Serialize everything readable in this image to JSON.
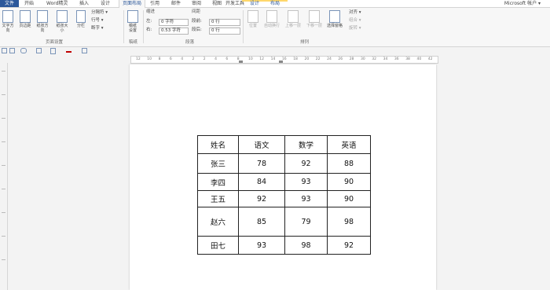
{
  "tabs": {
    "file": "文件",
    "items": [
      "开始",
      "Word精灵",
      "插入",
      "设计",
      "页面布局",
      "引用",
      "邮件",
      "审阅",
      "视图",
      "开发工具",
      "设计",
      "布局"
    ],
    "active_index": 4,
    "account": "Microsoft 帐户 ▾"
  },
  "ribbon": {
    "page_setup": {
      "buttons": [
        "文字方向",
        "页边距",
        "纸张方向",
        "纸张大小",
        "分栏"
      ],
      "small": [
        "分隔符 ▾",
        "行号 ▾",
        "断字 ▾"
      ],
      "label": "页面设置"
    },
    "draft": {
      "button": "稿纸\n设置",
      "label": "稿纸"
    },
    "paragraph": {
      "indent_title": "缩进",
      "spacing_title": "间距",
      "left_label": "左:",
      "left_value": "0 字符",
      "right_label": "右:",
      "right_value": "0.53 字符",
      "before_label": "段前:",
      "before_value": "0 行",
      "after_label": "段后:",
      "after_value": "0 行",
      "label": "段落"
    },
    "arrange": {
      "buttons": [
        "位置",
        "自动换行",
        "上移一层",
        "下移一层",
        "选择窗格"
      ],
      "small": [
        "对齐 ▾",
        "组合 ▾",
        "旋转 ▾"
      ],
      "label": "排列"
    }
  },
  "ruler": {
    "ticks": [
      "12",
      "10",
      "8",
      "6",
      "4",
      "2",
      "2",
      "4",
      "6",
      "8",
      "10",
      "12",
      "14",
      "16",
      "18",
      "20",
      "22",
      "24",
      "26",
      "28",
      "30",
      "32",
      "34",
      "36",
      "38",
      "40",
      "42"
    ]
  },
  "table": {
    "headers": [
      "姓名",
      "语文",
      "数学",
      "英语"
    ],
    "rows": [
      [
        "张三",
        "78",
        "92",
        "88"
      ],
      [
        "李四",
        "84",
        "93",
        "90"
      ],
      [
        "王五",
        "92",
        "93",
        "90"
      ],
      [
        "赵六",
        "85",
        "79",
        "98"
      ],
      [
        "田七",
        "93",
        "98",
        "92"
      ]
    ]
  }
}
